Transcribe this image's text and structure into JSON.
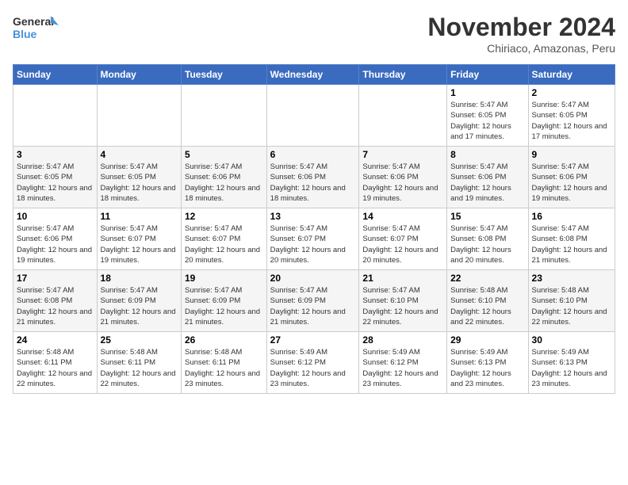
{
  "header": {
    "logo_line1": "General",
    "logo_line2": "Blue",
    "month_title": "November 2024",
    "location": "Chiriaco, Amazonas, Peru"
  },
  "weekdays": [
    "Sunday",
    "Monday",
    "Tuesday",
    "Wednesday",
    "Thursday",
    "Friday",
    "Saturday"
  ],
  "weeks": [
    [
      {
        "day": "",
        "info": ""
      },
      {
        "day": "",
        "info": ""
      },
      {
        "day": "",
        "info": ""
      },
      {
        "day": "",
        "info": ""
      },
      {
        "day": "",
        "info": ""
      },
      {
        "day": "1",
        "info": "Sunrise: 5:47 AM\nSunset: 6:05 PM\nDaylight: 12 hours and 17 minutes."
      },
      {
        "day": "2",
        "info": "Sunrise: 5:47 AM\nSunset: 6:05 PM\nDaylight: 12 hours and 17 minutes."
      }
    ],
    [
      {
        "day": "3",
        "info": "Sunrise: 5:47 AM\nSunset: 6:05 PM\nDaylight: 12 hours and 18 minutes."
      },
      {
        "day": "4",
        "info": "Sunrise: 5:47 AM\nSunset: 6:05 PM\nDaylight: 12 hours and 18 minutes."
      },
      {
        "day": "5",
        "info": "Sunrise: 5:47 AM\nSunset: 6:06 PM\nDaylight: 12 hours and 18 minutes."
      },
      {
        "day": "6",
        "info": "Sunrise: 5:47 AM\nSunset: 6:06 PM\nDaylight: 12 hours and 18 minutes."
      },
      {
        "day": "7",
        "info": "Sunrise: 5:47 AM\nSunset: 6:06 PM\nDaylight: 12 hours and 19 minutes."
      },
      {
        "day": "8",
        "info": "Sunrise: 5:47 AM\nSunset: 6:06 PM\nDaylight: 12 hours and 19 minutes."
      },
      {
        "day": "9",
        "info": "Sunrise: 5:47 AM\nSunset: 6:06 PM\nDaylight: 12 hours and 19 minutes."
      }
    ],
    [
      {
        "day": "10",
        "info": "Sunrise: 5:47 AM\nSunset: 6:06 PM\nDaylight: 12 hours and 19 minutes."
      },
      {
        "day": "11",
        "info": "Sunrise: 5:47 AM\nSunset: 6:07 PM\nDaylight: 12 hours and 19 minutes."
      },
      {
        "day": "12",
        "info": "Sunrise: 5:47 AM\nSunset: 6:07 PM\nDaylight: 12 hours and 20 minutes."
      },
      {
        "day": "13",
        "info": "Sunrise: 5:47 AM\nSunset: 6:07 PM\nDaylight: 12 hours and 20 minutes."
      },
      {
        "day": "14",
        "info": "Sunrise: 5:47 AM\nSunset: 6:07 PM\nDaylight: 12 hours and 20 minutes."
      },
      {
        "day": "15",
        "info": "Sunrise: 5:47 AM\nSunset: 6:08 PM\nDaylight: 12 hours and 20 minutes."
      },
      {
        "day": "16",
        "info": "Sunrise: 5:47 AM\nSunset: 6:08 PM\nDaylight: 12 hours and 21 minutes."
      }
    ],
    [
      {
        "day": "17",
        "info": "Sunrise: 5:47 AM\nSunset: 6:08 PM\nDaylight: 12 hours and 21 minutes."
      },
      {
        "day": "18",
        "info": "Sunrise: 5:47 AM\nSunset: 6:09 PM\nDaylight: 12 hours and 21 minutes."
      },
      {
        "day": "19",
        "info": "Sunrise: 5:47 AM\nSunset: 6:09 PM\nDaylight: 12 hours and 21 minutes."
      },
      {
        "day": "20",
        "info": "Sunrise: 5:47 AM\nSunset: 6:09 PM\nDaylight: 12 hours and 21 minutes."
      },
      {
        "day": "21",
        "info": "Sunrise: 5:47 AM\nSunset: 6:10 PM\nDaylight: 12 hours and 22 minutes."
      },
      {
        "day": "22",
        "info": "Sunrise: 5:48 AM\nSunset: 6:10 PM\nDaylight: 12 hours and 22 minutes."
      },
      {
        "day": "23",
        "info": "Sunrise: 5:48 AM\nSunset: 6:10 PM\nDaylight: 12 hours and 22 minutes."
      }
    ],
    [
      {
        "day": "24",
        "info": "Sunrise: 5:48 AM\nSunset: 6:11 PM\nDaylight: 12 hours and 22 minutes."
      },
      {
        "day": "25",
        "info": "Sunrise: 5:48 AM\nSunset: 6:11 PM\nDaylight: 12 hours and 22 minutes."
      },
      {
        "day": "26",
        "info": "Sunrise: 5:48 AM\nSunset: 6:11 PM\nDaylight: 12 hours and 23 minutes."
      },
      {
        "day": "27",
        "info": "Sunrise: 5:49 AM\nSunset: 6:12 PM\nDaylight: 12 hours and 23 minutes."
      },
      {
        "day": "28",
        "info": "Sunrise: 5:49 AM\nSunset: 6:12 PM\nDaylight: 12 hours and 23 minutes."
      },
      {
        "day": "29",
        "info": "Sunrise: 5:49 AM\nSunset: 6:13 PM\nDaylight: 12 hours and 23 minutes."
      },
      {
        "day": "30",
        "info": "Sunrise: 5:49 AM\nSunset: 6:13 PM\nDaylight: 12 hours and 23 minutes."
      }
    ]
  ]
}
